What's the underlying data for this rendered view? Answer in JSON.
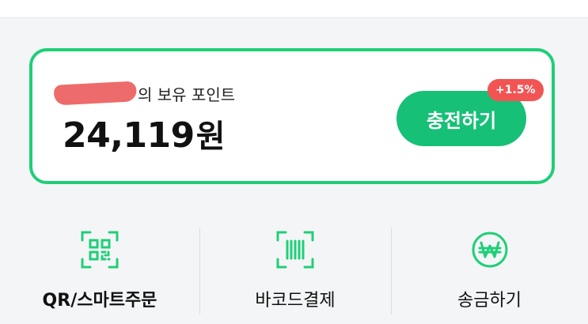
{
  "points": {
    "label_suffix": "의 보유 포인트",
    "amount": "24,119",
    "unit": "원"
  },
  "charge": {
    "label": "충전하기",
    "badge": "+1.5%"
  },
  "menu": [
    {
      "label": "QR/스마트주문",
      "icon": "qr-icon"
    },
    {
      "label": "바코드결제",
      "icon": "barcode-icon"
    },
    {
      "label": "송금하기",
      "icon": "won-icon"
    }
  ],
  "colors": {
    "accent": "#1fcf78",
    "button": "#17c077",
    "badge": "#f25454",
    "redaction": "#ee6b6b"
  }
}
